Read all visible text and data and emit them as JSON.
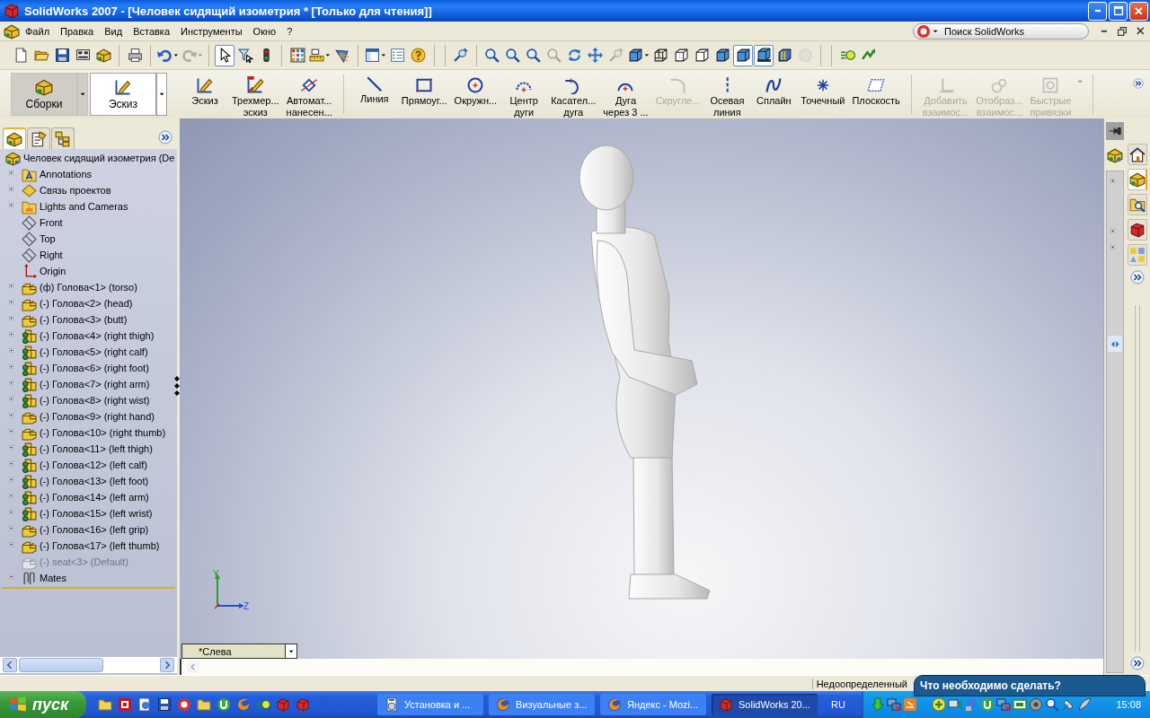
{
  "window": {
    "title": "SolidWorks 2007 - [Человек сидящий изометрия * [Только для чтения]]"
  },
  "menu": {
    "items": [
      "Файл",
      "Правка",
      "Вид",
      "Вставка",
      "Инструменты",
      "Окно",
      "?"
    ]
  },
  "search": {
    "placeholder": "Поиск SolidWorks"
  },
  "toolbar": {
    "groups": [
      [
        {
          "kind": "new",
          "pressed": false,
          "disabled": false,
          "dropdown": false
        },
        {
          "kind": "open",
          "pressed": false,
          "disabled": false,
          "dropdown": false
        },
        {
          "kind": "save",
          "pressed": false,
          "disabled": false,
          "dropdown": false
        },
        {
          "kind": "form",
          "pressed": false,
          "disabled": false,
          "dropdown": false
        },
        {
          "kind": "blocks",
          "pressed": false,
          "disabled": false,
          "dropdown": false
        }
      ],
      [
        {
          "kind": "print",
          "pressed": false,
          "disabled": false,
          "dropdown": false
        }
      ],
      [
        {
          "kind": "undo",
          "pressed": false,
          "disabled": false,
          "dropdown": true
        },
        {
          "kind": "redo",
          "pressed": false,
          "disabled": true,
          "dropdown": true
        }
      ],
      [
        {
          "kind": "select",
          "pressed": true,
          "disabled": false,
          "dropdown": false
        },
        {
          "kind": "filter",
          "pressed": false,
          "disabled": false,
          "dropdown": false
        },
        {
          "kind": "rebuild",
          "pressed": false,
          "disabled": false,
          "dropdown": false
        }
      ],
      [
        {
          "kind": "grid",
          "pressed": false,
          "disabled": false,
          "dropdown": false
        },
        {
          "kind": "measure",
          "pressed": false,
          "disabled": false,
          "dropdown": true
        },
        {
          "kind": "spectrum",
          "pressed": false,
          "disabled": false,
          "dropdown": false
        }
      ],
      [
        {
          "kind": "panel",
          "pressed": false,
          "disabled": false,
          "dropdown": true
        },
        {
          "kind": "list",
          "pressed": false,
          "disabled": false,
          "dropdown": false
        },
        {
          "kind": "help",
          "pressed": false,
          "disabled": false,
          "dropdown": false
        }
      ],
      [
        {
          "kind": "probe",
          "pressed": false,
          "disabled": false,
          "dropdown": false
        }
      ],
      [
        {
          "kind": "zoom",
          "pressed": false,
          "disabled": false,
          "dropdown": false
        },
        {
          "kind": "zoom",
          "pressed": false,
          "disabled": false,
          "dropdown": false
        },
        {
          "kind": "zoom",
          "pressed": false,
          "disabled": false,
          "dropdown": false
        },
        {
          "kind": "zoom",
          "pressed": false,
          "disabled": true,
          "dropdown": false
        },
        {
          "kind": "rotate",
          "pressed": false,
          "disabled": false,
          "dropdown": false
        },
        {
          "kind": "pan",
          "pressed": false,
          "disabled": false,
          "dropdown": false
        },
        {
          "kind": "probe",
          "pressed": false,
          "disabled": true,
          "dropdown": false
        },
        {
          "kind": "cube",
          "pressed": false,
          "disabled": false,
          "dropdown": true
        },
        {
          "kind": "wire",
          "pressed": false,
          "disabled": false,
          "dropdown": false
        },
        {
          "kind": "hidden",
          "pressed": false,
          "disabled": false,
          "dropdown": false
        },
        {
          "kind": "removed",
          "pressed": false,
          "disabled": false,
          "dropdown": false
        },
        {
          "kind": "cube",
          "pressed": false,
          "disabled": false,
          "dropdown": false
        },
        {
          "kind": "cube",
          "pressed": true,
          "disabled": false,
          "dropdown": false
        },
        {
          "kind": "shadow",
          "pressed": true,
          "disabled": false,
          "dropdown": false
        },
        {
          "kind": "section",
          "pressed": false,
          "disabled": false,
          "dropdown": false
        },
        {
          "kind": "sphere",
          "pressed": false,
          "disabled": true,
          "dropdown": false
        }
      ],
      [
        {
          "kind": "edraw",
          "pressed": false,
          "disabled": false,
          "dropdown": false
        },
        {
          "kind": "arrows",
          "pressed": false,
          "disabled": false,
          "dropdown": false
        }
      ]
    ]
  },
  "command_manager": {
    "tabs": [
      {
        "label": "Сборки",
        "kind": "blocks",
        "selected": false
      },
      {
        "label": "Эскиз",
        "kind": "sketch",
        "selected": true
      }
    ],
    "groups": [
      [
        {
          "kind": "sketch",
          "lines": [
            "Эскиз"
          ],
          "disabled": false
        },
        {
          "kind": "sketch3d",
          "lines": [
            "Трехмер...",
            "эскиз"
          ],
          "disabled": false
        },
        {
          "kind": "dimension",
          "lines": [
            "Автомат...",
            "нанесен..."
          ],
          "disabled": false
        }
      ],
      [
        {
          "kind": "line",
          "lines": [
            "Линия"
          ],
          "disabled": false
        },
        {
          "kind": "rect",
          "lines": [
            "Прямоуг..."
          ],
          "disabled": false
        },
        {
          "kind": "circle",
          "lines": [
            "Окружн..."
          ],
          "disabled": false
        },
        {
          "kind": "arcc",
          "lines": [
            "Центр",
            "дуги"
          ],
          "disabled": false
        },
        {
          "kind": "arct",
          "lines": [
            "Касател...",
            "дуга"
          ],
          "disabled": false
        },
        {
          "kind": "arc3",
          "lines": [
            "Дуга",
            "через 3 ..."
          ],
          "disabled": false
        },
        {
          "kind": "fillet",
          "lines": [
            "Скругле..."
          ],
          "disabled": true
        },
        {
          "kind": "centerline",
          "lines": [
            "Осевая",
            "линия"
          ],
          "disabled": false
        },
        {
          "kind": "spline",
          "lines": [
            "Сплайн"
          ],
          "disabled": false
        },
        {
          "kind": "point",
          "lines": [
            "Точечный"
          ],
          "disabled": false
        },
        {
          "kind": "plane",
          "lines": [
            "Плоскость"
          ],
          "disabled": false
        }
      ],
      [
        {
          "kind": "relation",
          "lines": [
            "Добавить",
            "взаимос..."
          ],
          "disabled": true
        },
        {
          "kind": "relations",
          "lines": [
            "Отобраз...",
            "взаимос..."
          ],
          "disabled": true
        },
        {
          "kind": "snap",
          "lines": [
            "Быстрые",
            "привязки"
          ],
          "disabled": true
        }
      ]
    ]
  },
  "tree": {
    "tabs": [
      {
        "kind": "blocks",
        "selected": true
      },
      {
        "kind": "clipboard",
        "selected": false
      },
      {
        "kind": "config",
        "selected": false
      }
    ],
    "root": {
      "label": "Человек сидящий изометрия  (De",
      "kind": "assembly",
      "children": [
        {
          "label": "Annotations",
          "kind": "annotations",
          "expandable": true,
          "suppressed": false
        },
        {
          "label": "Связь проектов",
          "kind": "binder",
          "expandable": true,
          "suppressed": false
        },
        {
          "label": "Lights and Cameras",
          "kind": "lights",
          "expandable": true,
          "suppressed": false
        },
        {
          "label": "Front",
          "kind": "plane",
          "expandable": false,
          "suppressed": false
        },
        {
          "label": "Top",
          "kind": "plane",
          "expandable": false,
          "suppressed": false
        },
        {
          "label": "Right",
          "kind": "plane",
          "expandable": false,
          "suppressed": false
        },
        {
          "label": "Origin",
          "kind": "origin",
          "expandable": false,
          "suppressed": false
        },
        {
          "label": "(ф) Голова<1> (torso)",
          "kind": "part",
          "expandable": true,
          "suppressed": false
        },
        {
          "label": "(-) Голова<2> (head)",
          "kind": "part",
          "expandable": true,
          "suppressed": false
        },
        {
          "label": "(-) Голова<3> (butt)",
          "kind": "part",
          "expandable": true,
          "suppressed": false
        },
        {
          "label": "(-) Голова<4> (right thigh)",
          "kind": "subassembly",
          "expandable": true,
          "suppressed": false
        },
        {
          "label": "(-) Голова<5> (right calf)",
          "kind": "subassembly",
          "expandable": true,
          "suppressed": false
        },
        {
          "label": "(-) Голова<6> (right foot)",
          "kind": "subassembly",
          "expandable": true,
          "suppressed": false
        },
        {
          "label": "(-) Голова<7> (right arm)",
          "kind": "subassembly",
          "expandable": true,
          "suppressed": false
        },
        {
          "label": "(-) Голова<8> (right wist)",
          "kind": "subassembly",
          "expandable": true,
          "suppressed": false
        },
        {
          "label": "(-) Голова<9> (right hand)",
          "kind": "part",
          "expandable": true,
          "suppressed": false
        },
        {
          "label": "(-) Голова<10> (right thumb)",
          "kind": "part",
          "expandable": true,
          "suppressed": false
        },
        {
          "label": "(-) Голова<11> (left thigh)",
          "kind": "subassembly",
          "expandable": true,
          "suppressed": false
        },
        {
          "label": "(-) Голова<12> (left calf)",
          "kind": "subassembly",
          "expandable": true,
          "suppressed": false
        },
        {
          "label": "(-) Голова<13> (left foot)",
          "kind": "subassembly",
          "expandable": true,
          "suppressed": false
        },
        {
          "label": "(-) Голова<14> (left arm)",
          "kind": "subassembly",
          "expandable": true,
          "suppressed": false
        },
        {
          "label": "(-) Голова<15> (left wrist)",
          "kind": "subassembly",
          "expandable": true,
          "suppressed": false
        },
        {
          "label": "(-) Голова<16> (left grip)",
          "kind": "part",
          "expandable": true,
          "suppressed": false
        },
        {
          "label": "(-) Голова<17> (left thumb)",
          "kind": "part",
          "expandable": true,
          "suppressed": false
        },
        {
          "label": "(-) seat<3> (Default)",
          "kind": "part",
          "expandable": false,
          "suppressed": true
        },
        {
          "label": "Mates",
          "kind": "mates",
          "expandable": true,
          "suppressed": false
        }
      ]
    }
  },
  "viewport": {
    "orientation": "*Слева",
    "triad": {
      "y_label": "Y",
      "z_label": "Z"
    }
  },
  "task_pane": {
    "tabs": [
      {
        "kind": "home",
        "selected": false
      },
      {
        "kind": "blocks",
        "selected": true
      },
      {
        "kind": "search",
        "selected": false
      },
      {
        "kind": "redcube",
        "selected": false
      },
      {
        "kind": "shapes",
        "selected": false
      }
    ]
  },
  "status_bar": {
    "text": "Недоопределенный"
  },
  "balloon": {
    "text": "Что необходимо сделать?"
  },
  "taskbar": {
    "start": "пуск",
    "tasks": [
      {
        "label": "Установка и ...",
        "kind": "installer",
        "selected": false
      },
      {
        "label": "Визуальные з...",
        "kind": "browser",
        "selected": false
      },
      {
        "label": "Яндекс - Mozi...",
        "kind": "browser",
        "selected": false
      },
      {
        "label": "SolidWorks 20...",
        "kind": "redcube",
        "selected": true
      }
    ],
    "language": "RU",
    "clock": "15:08"
  }
}
